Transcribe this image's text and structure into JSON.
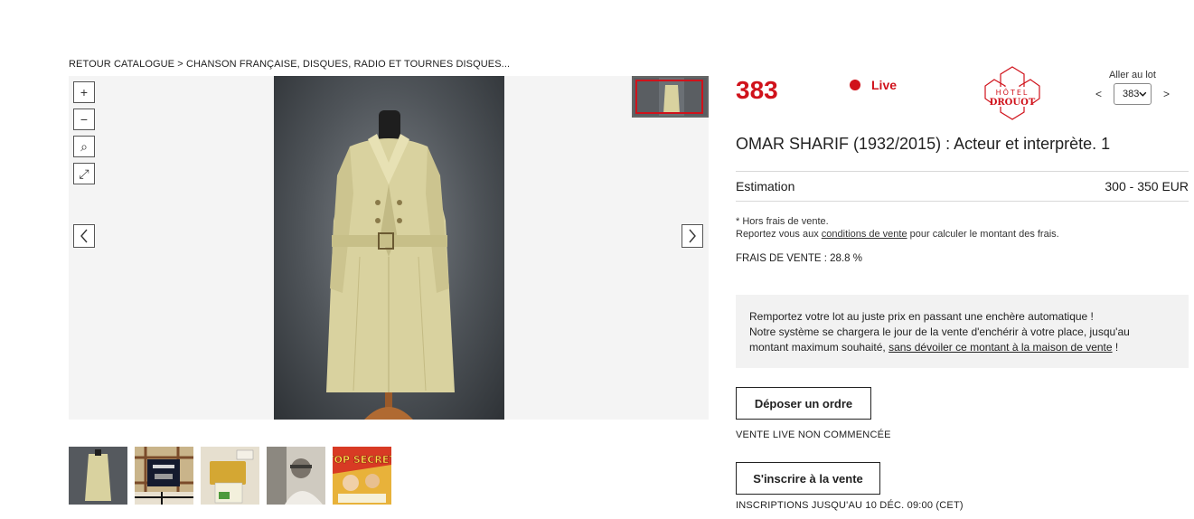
{
  "breadcrumb": "RETOUR CATALOGUE > CHANSON FRANÇAISE, DISQUES, RADIO ET TOURNES DISQUES...",
  "viewer": {
    "zoom_in": "+",
    "zoom_out": "−",
    "zoom_reset": "⌕",
    "fullscreen": "⤢"
  },
  "lot": {
    "number": "383",
    "live_label": "Live",
    "title": "OMAR SHARIF (1932/2015) : Acteur et interprète. 1"
  },
  "logo": {
    "line1": "HÔTEL",
    "line2": "DROUOT"
  },
  "goto": {
    "label": "Aller au lot",
    "prev": "<",
    "next": ">",
    "selected": "383"
  },
  "estimation": {
    "label": "Estimation",
    "value": "300 - 350 EUR"
  },
  "fees": {
    "note_line1": "* Hors frais de vente.",
    "note_prefix": "Reportez vous aux ",
    "note_link": "conditions de vente",
    "note_suffix": " pour calculer le montant des frais.",
    "frais": "FRAIS DE VENTE : 28.8 %"
  },
  "promo": {
    "line1": "Remportez votre lot au juste prix en passant une enchère automatique !",
    "line2": "Notre système se chargera le jour de la vente d'enchérir à votre place, jusqu'au",
    "line3_prefix": "montant maximum souhaité, ",
    "line3_link": "sans dévoiler ce montant à la maison de vente",
    "line3_suffix": " !"
  },
  "actions": {
    "ordre_label": "Déposer un ordre",
    "status": "VENTE LIVE NON COMMENCÉE",
    "inscrire_label": "S'inscrire à la vente",
    "inscriptions": "INSCRIPTIONS JUSQU'AU 10 DÉC. 09:00 (CET)"
  },
  "thumbnails": {
    "top_secret": "TOP SECRET"
  },
  "colors": {
    "accent": "#d0121b",
    "promo_bg": "#f2f2f2"
  }
}
